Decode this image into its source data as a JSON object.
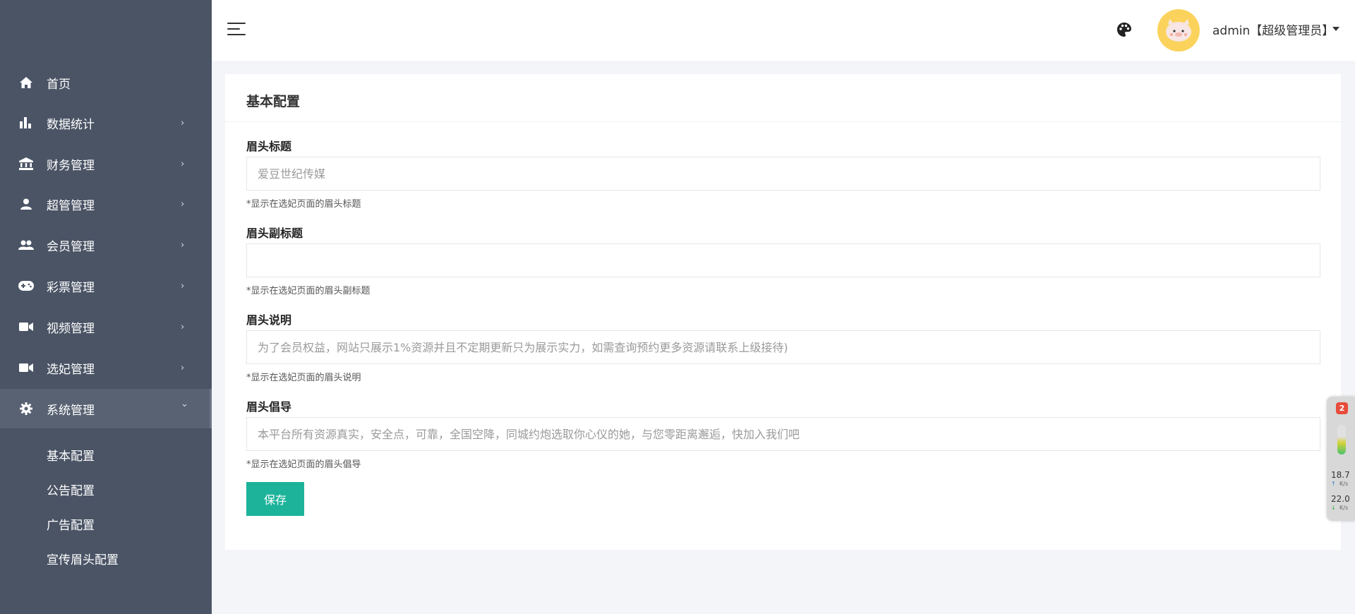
{
  "sidebar": {
    "items": [
      {
        "label": "首页",
        "icon": "home-icon"
      },
      {
        "label": "数据统计",
        "icon": "bar-chart-icon"
      },
      {
        "label": "财务管理",
        "icon": "bank-icon"
      },
      {
        "label": "超管管理",
        "icon": "person-icon"
      },
      {
        "label": "会员管理",
        "icon": "people-icon"
      },
      {
        "label": "彩票管理",
        "icon": "gamepad-icon"
      },
      {
        "label": "视频管理",
        "icon": "video-icon"
      },
      {
        "label": "选妃管理",
        "icon": "video-icon"
      },
      {
        "label": "系统管理",
        "icon": "gear-icon"
      }
    ],
    "chevron_right": "›",
    "chevron_down": "⌄",
    "sub_items": [
      "基本配置",
      "公告配置",
      "广告配置",
      "宣传眉头配置"
    ]
  },
  "header": {
    "user": "admin【超级管理员】"
  },
  "card": {
    "title": "基本配置",
    "fields": [
      {
        "label": "眉头标题",
        "value": "",
        "placeholder": "爱豆世纪传媒",
        "hint": "*显示在选妃页面的眉头标题"
      },
      {
        "label": "眉头副标题",
        "value": "",
        "placeholder": "",
        "hint": "*显示在选妃页面的眉头副标题"
      },
      {
        "label": "眉头说明",
        "value": "",
        "placeholder": "为了会员权益，网站只展示1%资源并且不定期更新只为展示实力，如需查询预约更多资源请联系上级接待)",
        "hint": "*显示在选妃页面的眉头说明"
      },
      {
        "label": "眉头倡导",
        "value": "",
        "placeholder": "本平台所有资源真实，安全点，可靠，全国空降，同城约炮选取你心仪的她，与您零距离邂逅，快加入我们吧",
        "hint": "*显示在选妃页面的眉头倡导"
      }
    ],
    "save_label": "保存"
  },
  "widget": {
    "badge": "2",
    "up_speed": "18.7",
    "down_speed": "22.0",
    "unit": "K/s",
    "up_arrow": "↑",
    "down_arrow": "↓"
  },
  "colors": {
    "sidebar_bg": "#4a5465",
    "sidebar_active": "#586272",
    "accent": "#1db39b",
    "avatar_bg": "#fbd35c"
  }
}
